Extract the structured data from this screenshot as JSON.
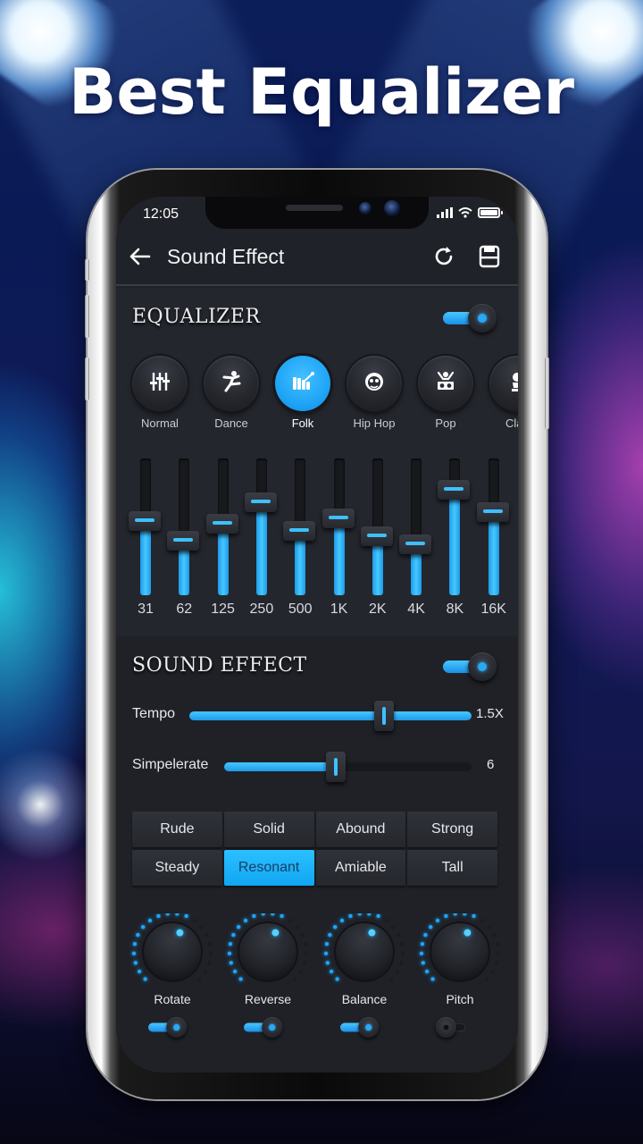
{
  "promo": {
    "headline": "Best Equalizer"
  },
  "status_bar": {
    "time": "12:05",
    "signal_icon": "signal-bars-icon",
    "wifi_icon": "wifi-icon",
    "battery_icon": "battery-icon"
  },
  "app_bar": {
    "title": "Sound Effect",
    "back_icon": "arrow-left-icon",
    "reset_icon": "refresh-icon",
    "save_icon": "floppy-disk-icon"
  },
  "equalizer": {
    "title": "EQUALIZER",
    "enabled": true,
    "presets": [
      {
        "label": "Normal",
        "icon": "sliders-icon",
        "active": false
      },
      {
        "label": "Dance",
        "icon": "dancer-icon",
        "active": false
      },
      {
        "label": "Folk",
        "icon": "xylophone-icon",
        "active": true
      },
      {
        "label": "Hip Hop",
        "icon": "rapper-face-icon",
        "active": false
      },
      {
        "label": "Pop",
        "icon": "dj-icon",
        "active": false
      },
      {
        "label": "Clas",
        "icon": "classical-bust-icon",
        "active": false
      }
    ],
    "bands": [
      {
        "freq": "31",
        "level": 0.54
      },
      {
        "freq": "62",
        "level": 0.4
      },
      {
        "freq": "125",
        "level": 0.52
      },
      {
        "freq": "250",
        "level": 0.68
      },
      {
        "freq": "500",
        "level": 0.47
      },
      {
        "freq": "1K",
        "level": 0.56
      },
      {
        "freq": "2K",
        "level": 0.43
      },
      {
        "freq": "4K",
        "level": 0.37
      },
      {
        "freq": "8K",
        "level": 0.77
      },
      {
        "freq": "16K",
        "level": 0.61
      }
    ]
  },
  "sound_effect": {
    "title": "SOUND EFFECT",
    "enabled": true,
    "sliders": [
      {
        "label": "Tempo",
        "value": "1.5X",
        "fraction": 0.69,
        "full_track_lit": true
      },
      {
        "label": "Simpelerate",
        "value": "6",
        "fraction": 0.45,
        "full_track_lit": false
      }
    ],
    "modes": [
      {
        "label": "Rude",
        "active": false
      },
      {
        "label": "Solid",
        "active": false
      },
      {
        "label": "Abound",
        "active": false
      },
      {
        "label": "Strong",
        "active": false
      },
      {
        "label": "Steady",
        "active": false
      },
      {
        "label": "Resonant",
        "active": true
      },
      {
        "label": "Amiable",
        "active": false
      },
      {
        "label": "Tall",
        "active": false
      }
    ],
    "knobs": [
      {
        "label": "Rotate",
        "level": 0.62,
        "enabled": true
      },
      {
        "label": "Reverse",
        "level": 0.62,
        "enabled": true
      },
      {
        "label": "Balance",
        "level": 0.62,
        "enabled": true
      },
      {
        "label": "Pitch",
        "level": 0.62,
        "enabled": false
      }
    ]
  },
  "colors": {
    "accent": "#1fa5f7",
    "screen_bg": "#202229",
    "active_mode_text": "#1b3e66"
  }
}
